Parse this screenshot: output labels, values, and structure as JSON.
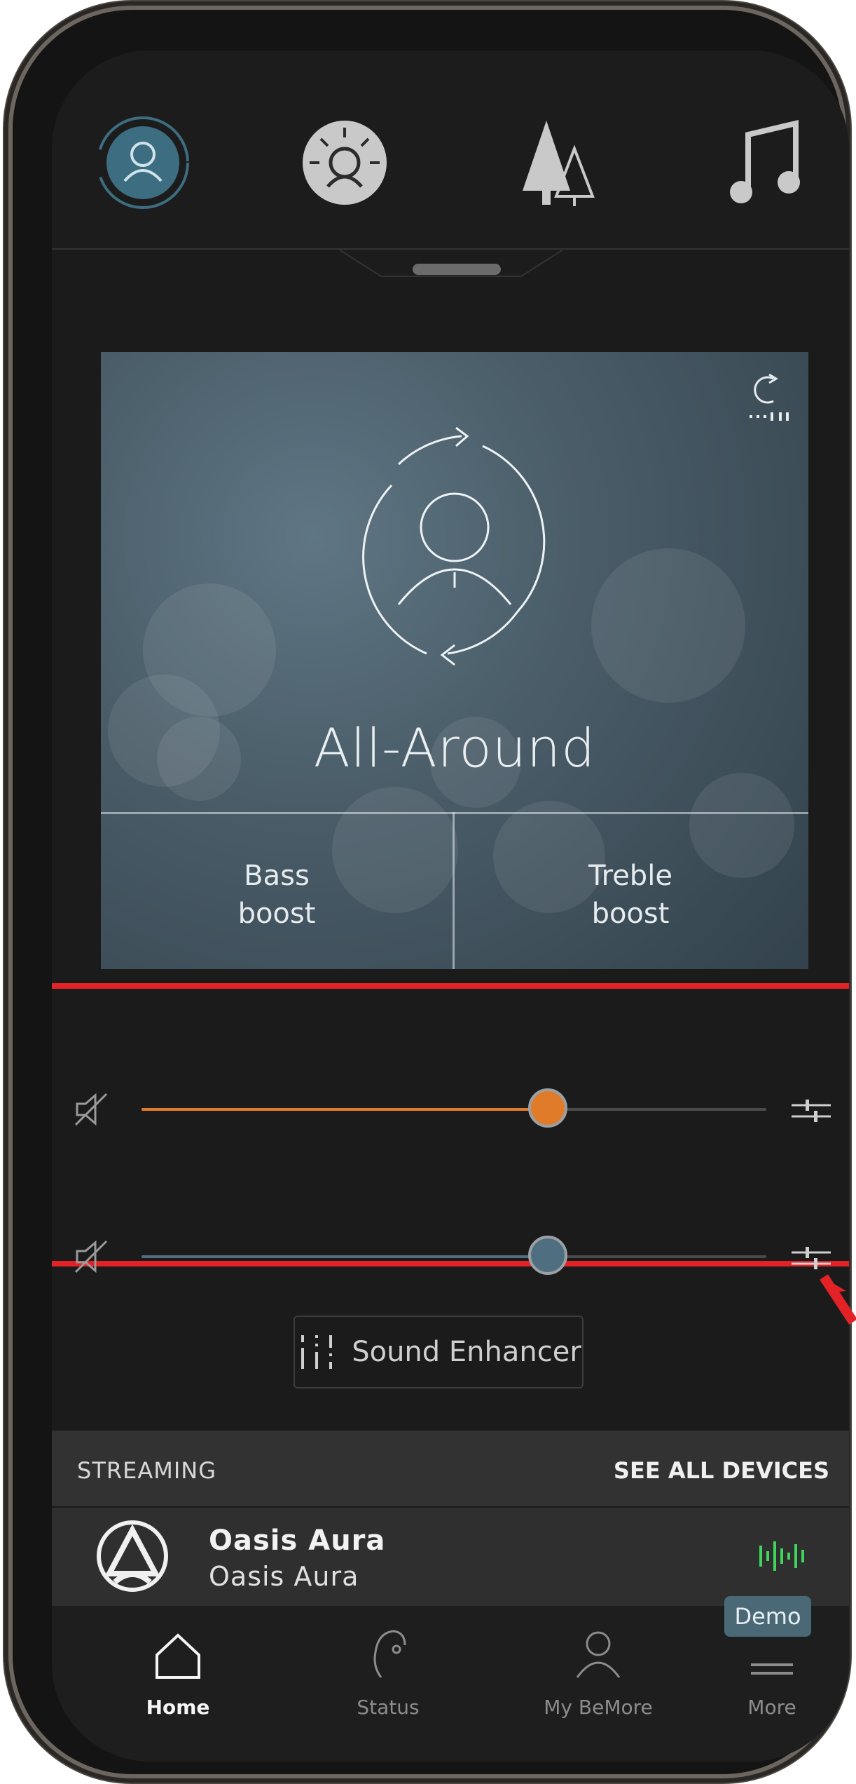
{
  "modes": {
    "items": [
      {
        "name": "all-around-mode",
        "active": true
      },
      {
        "name": "social-mode",
        "active": false
      },
      {
        "name": "outdoor-mode",
        "active": false
      },
      {
        "name": "music-mode",
        "active": false
      }
    ]
  },
  "program": {
    "name": "All-Around",
    "bass_label": "Bass\nboost",
    "treble_label": "Treble\nboost"
  },
  "sliders": [
    {
      "name": "volume-slider-1",
      "value_fraction": 0.65,
      "color": "#e07b2a"
    },
    {
      "name": "volume-slider-2",
      "value_fraction": 0.65,
      "color": "#4f6f80"
    }
  ],
  "sound_enhancer": {
    "label": "Sound Enhancer"
  },
  "streaming": {
    "title": "STREAMING",
    "see_all": "SEE ALL DEVICES",
    "device_name": "Oasis Aura",
    "device_sub": "Oasis Aura",
    "indicator_color": "#3fd45a"
  },
  "nav": {
    "items": [
      {
        "label": "Home",
        "active": true
      },
      {
        "label": "Status",
        "active": false
      },
      {
        "label": "My BeMore",
        "active": false
      },
      {
        "label": "More",
        "active": false
      }
    ],
    "demo": "Demo"
  },
  "colors": {
    "accent_active": "#3d6d80",
    "highlight": "#e32227",
    "arrow": "#e32227"
  }
}
